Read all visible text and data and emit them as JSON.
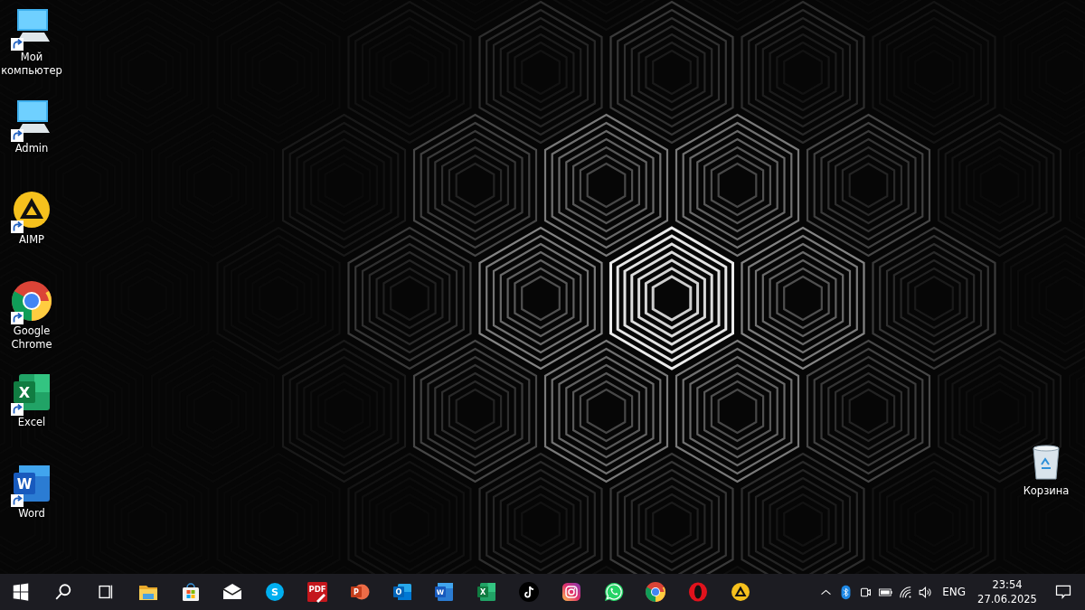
{
  "desktop_icons": [
    {
      "label": "Мой компьютер",
      "kind": "computer",
      "shortcut": true
    },
    {
      "label": "Admin",
      "kind": "computer",
      "shortcut": true
    },
    {
      "label": "AIMP",
      "kind": "aimp",
      "shortcut": true
    },
    {
      "label": "Google Chrome",
      "kind": "chrome",
      "shortcut": true
    },
    {
      "label": "Excel",
      "kind": "excel",
      "glyph": "X",
      "shortcut": true
    },
    {
      "label": "Word",
      "kind": "word",
      "glyph": "W",
      "shortcut": true
    }
  ],
  "desktop_icons_right": [
    {
      "label": "Корзина",
      "kind": "recycle",
      "shortcut": false
    }
  ],
  "taskbar": {
    "items": [
      {
        "kind": "start"
      },
      {
        "kind": "search"
      },
      {
        "kind": "taskview"
      },
      {
        "kind": "folder"
      },
      {
        "kind": "store"
      },
      {
        "kind": "mail"
      },
      {
        "kind": "skype",
        "glyph": "S"
      },
      {
        "kind": "pdf",
        "glyph": "PDF"
      },
      {
        "kind": "powerpoint",
        "glyph": "P"
      },
      {
        "kind": "outlook",
        "glyph": "O"
      },
      {
        "kind": "word",
        "glyph": "W"
      },
      {
        "kind": "excel",
        "glyph": "X"
      },
      {
        "kind": "tiktok"
      },
      {
        "kind": "instagram"
      },
      {
        "kind": "whatsapp"
      },
      {
        "kind": "chrome"
      },
      {
        "kind": "opera"
      },
      {
        "kind": "aimp"
      }
    ],
    "tray": [
      {
        "kind": "chevron"
      },
      {
        "kind": "bluetooth"
      },
      {
        "kind": "meet"
      },
      {
        "kind": "battery"
      },
      {
        "kind": "wifi"
      },
      {
        "kind": "volume"
      }
    ],
    "language": "ENG",
    "time": "23:54",
    "date": "27.06.2025"
  }
}
